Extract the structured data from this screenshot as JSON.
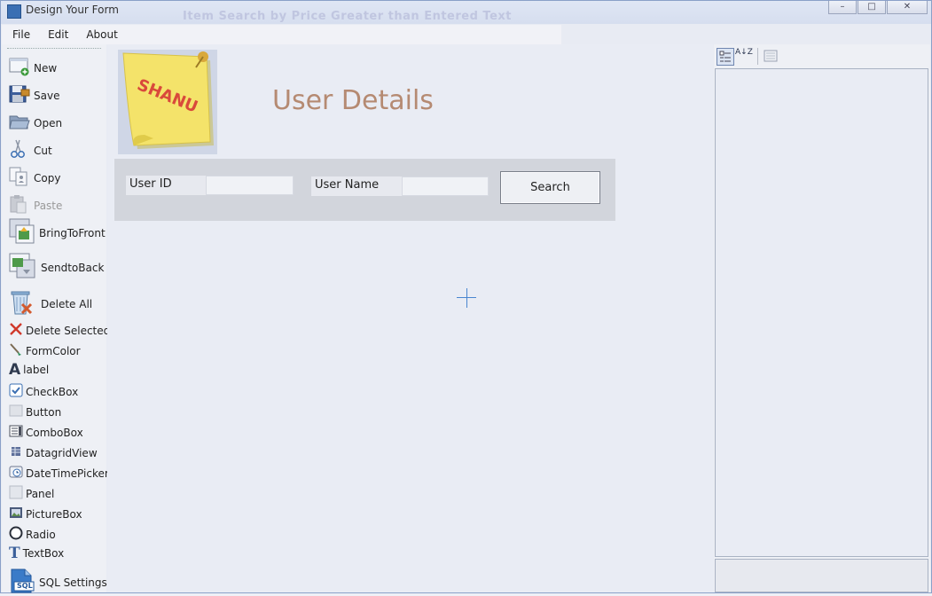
{
  "window": {
    "title": "Design Your Form",
    "ghost_title": "Item Search by Price Greater than Entered Text",
    "controls": {
      "minimize": "–",
      "maximize": "□",
      "close": "✕"
    }
  },
  "menu": {
    "items": [
      "File",
      "Edit",
      "About"
    ]
  },
  "toolbox": {
    "items": [
      {
        "label": "New",
        "icon": "new-form-icon"
      },
      {
        "label": "Save",
        "icon": "save-icon"
      },
      {
        "label": "Open",
        "icon": "folder-open-icon"
      },
      {
        "label": "Cut",
        "icon": "scissors-icon"
      },
      {
        "label": "Copy",
        "icon": "copy-icon"
      },
      {
        "label": "Paste",
        "icon": "clipboard-icon",
        "disabled": true
      },
      {
        "label": "BringToFront",
        "icon": "bring-to-front-icon"
      },
      {
        "label": "SendtoBack",
        "icon": "send-to-back-icon"
      },
      {
        "label": "Delete All",
        "icon": "trash-icon"
      },
      {
        "label": "Delete Selected",
        "icon": "red-x-icon"
      },
      {
        "label": "FormColor",
        "icon": "paint-brush-icon"
      },
      {
        "label": "label",
        "icon": "letter-a-icon"
      },
      {
        "label": "CheckBox",
        "icon": "checkbox-icon"
      },
      {
        "label": "Button",
        "icon": "button-icon"
      },
      {
        "label": "ComboBox",
        "icon": "combobox-icon"
      },
      {
        "label": "DatagridView",
        "icon": "grid-icon"
      },
      {
        "label": "DateTimePicker",
        "icon": "datetime-icon"
      },
      {
        "label": "Panel",
        "icon": "panel-icon"
      },
      {
        "label": "PictureBox",
        "icon": "picture-icon"
      },
      {
        "label": "Radio",
        "icon": "radio-icon"
      },
      {
        "label": "TextBox",
        "icon": "letter-t-icon"
      },
      {
        "label": "SQL Settings",
        "icon": "sql-file-icon",
        "badge": "SQL"
      }
    ]
  },
  "canvas": {
    "note_text": "SHANU",
    "heading": "User Details",
    "search": {
      "user_id_label": "User ID",
      "user_id_value": "",
      "user_name_label": "User Name",
      "user_name_value": "",
      "search_button": "Search"
    }
  },
  "property_grid": {
    "toolbar": [
      "categorized-icon",
      "alphabetical-sort-icon",
      "property-pages-icon"
    ],
    "sort_glyph": "A↓Z"
  },
  "colors": {
    "heading": "#b58a72",
    "note": "#f4e36a",
    "note_text": "#d9493b",
    "accent": "#4a86d0"
  }
}
